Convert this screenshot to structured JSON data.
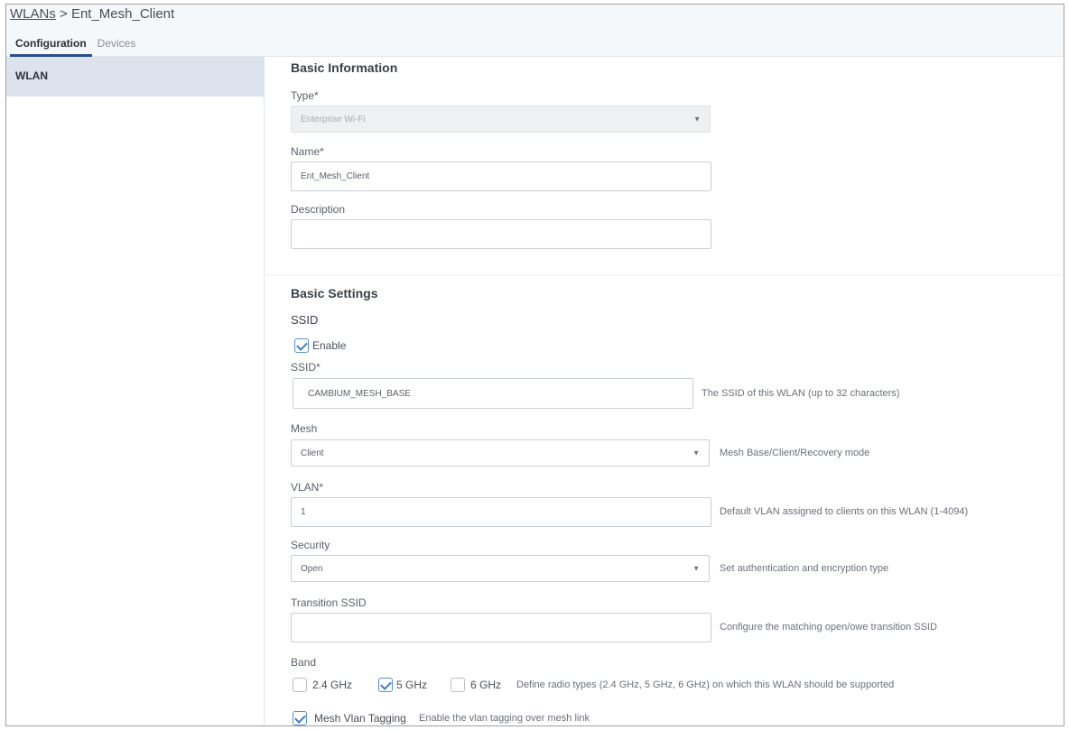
{
  "breadcrumb": {
    "root": "WLANs",
    "separator": ">",
    "current": "Ent_Mesh_Client"
  },
  "tabs": [
    {
      "label": "Configuration",
      "active": true
    },
    {
      "label": "Devices",
      "active": false
    }
  ],
  "sidebar": {
    "items": [
      {
        "label": "WLAN",
        "active": true
      }
    ]
  },
  "basic_information": {
    "title": "Basic Information",
    "type": {
      "label": "Type*",
      "value": "Enterprise Wi-Fi",
      "disabled": true
    },
    "name": {
      "label": "Name*",
      "value": "Ent_Mesh_Client"
    },
    "description": {
      "label": "Description",
      "value": ""
    }
  },
  "basic_settings": {
    "title": "Basic Settings",
    "ssid_heading": "SSID",
    "enable": {
      "label": "Enable",
      "checked": true
    },
    "ssid": {
      "label": "SSID*",
      "value": "CAMBIUM_MESH_BASE",
      "help": "The SSID of this WLAN (up to 32 characters)"
    },
    "mesh": {
      "label": "Mesh",
      "value": "Client",
      "help": "Mesh Base/Client/Recovery mode"
    },
    "vlan": {
      "label": "VLAN*",
      "value": "1",
      "help": "Default VLAN assigned to clients on this WLAN (1-4094)"
    },
    "security": {
      "label": "Security",
      "value": "Open",
      "help": "Set authentication and encryption type"
    },
    "transition_ssid": {
      "label": "Transition SSID",
      "value": "",
      "help": "Configure the matching open/owe transition SSID"
    },
    "band": {
      "label": "Band",
      "options": [
        {
          "label": "2.4 GHz",
          "checked": false
        },
        {
          "label": "5 GHz",
          "checked": true
        },
        {
          "label": "6 GHz",
          "checked": false
        }
      ],
      "help": "Define radio types (2.4 GHz, 5 GHz, 6 GHz) on which this WLAN should be supported"
    },
    "mesh_vlan_tagging": {
      "label": "Mesh Vlan Tagging",
      "checked": true,
      "help": "Enable the vlan tagging over mesh link"
    }
  },
  "icons": {
    "caret": "caret-down-icon",
    "check": "checkmark-icon"
  },
  "colors": {
    "accent": "#2a4f8a",
    "sidebar_active": "#dde3ec",
    "checkbox_check": "#3f7fcf"
  }
}
